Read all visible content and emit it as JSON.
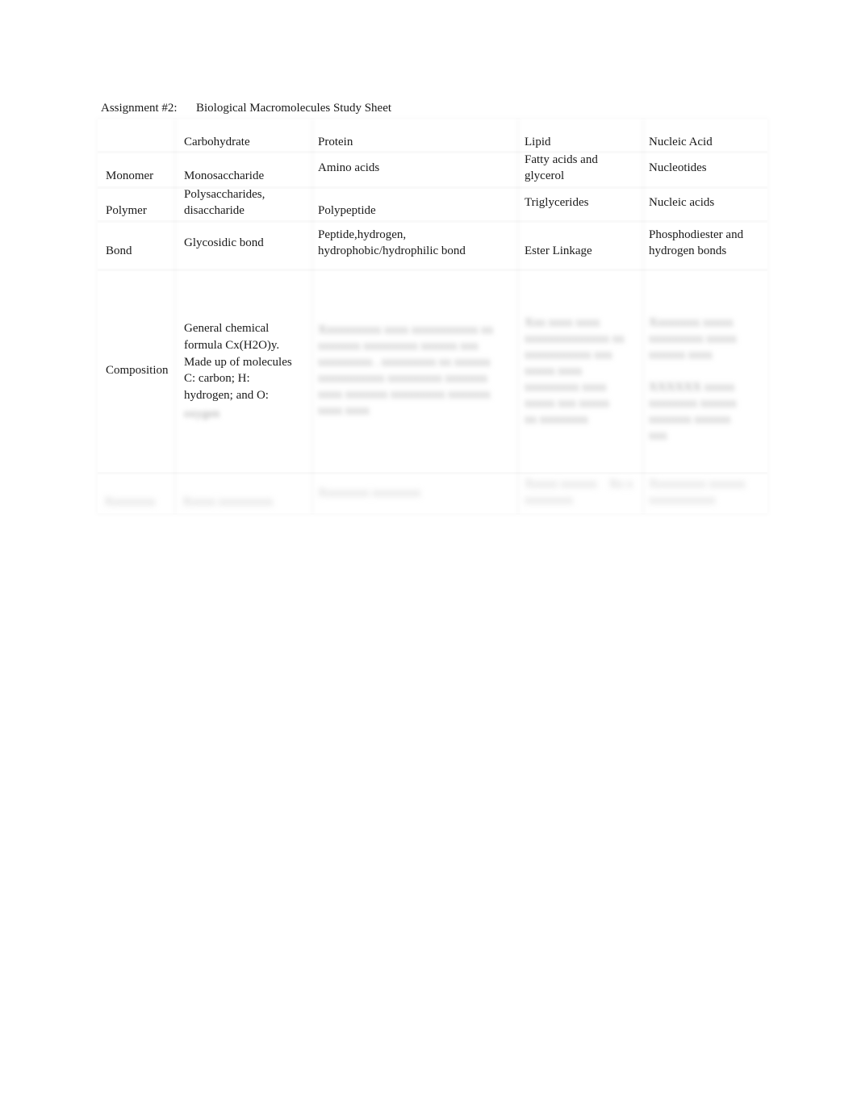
{
  "document": {
    "assignment_label": "Assignment #2:",
    "title": "Biological Macromolecules Study Sheet"
  },
  "table": {
    "columns": [
      "",
      "Carbohydrate",
      "Protein",
      "Lipid",
      "Nucleic Acid"
    ],
    "rows": [
      {
        "label": "Monomer",
        "carbohydrate": "Monosaccharide",
        "protein": "Amino acids",
        "lipid": "Fatty acids and glycerol",
        "nucleic_acid": "Nucleotides"
      },
      {
        "label": "Polymer",
        "carbohydrate": "Polysaccharides, disaccharide",
        "protein": "Polypeptide",
        "lipid": "Triglycerides",
        "nucleic_acid": "Nucleic acids"
      },
      {
        "label": "Bond",
        "carbohydrate": "Glycosidic bond",
        "protein": "Peptide,hydrogen, hydrophobic/hydrophilic bond",
        "lipid": "Ester Linkage",
        "nucleic_acid": "Phosphodiester and hydrogen bonds"
      },
      {
        "label": "Composition",
        "carbohydrate": "General chemical formula Cx(H2O)y. Made up of molecules C: carbon; H: hydrogen; and O:",
        "carbohydrate_hidden": "oxygen",
        "protein": "Blurred content not legible",
        "lipid": "Blurred content not legible",
        "nucleic_acid": "Blurred content not legible"
      },
      {
        "label": "Function",
        "carbohydrate": "Blurred content",
        "protein": "Blurred content",
        "lipid": "Blurred content",
        "nucleic_acid": "Blurred content"
      }
    ],
    "blur_placeholders": {
      "protein_comp_lines": [
        "Xxxxxxxxxx xxxx xxxxxxxxxxx xx",
        "xxxxxxx xxxxxxxxx xxxxxx xxx",
        "xxxxxxxxx  .  xxxxxxxxx xx xxxxxx",
        "xxxxxxxxxxx xxxxxxxxx xxxxxxx",
        "xxxx xxxxxxx xxxxxxxxx xxxxxxx",
        "xxxx xxxx"
      ],
      "lipid_comp_lines": [
        "Xxx xxxx xxxx",
        "xxxxxxxxxxxxxx xx",
        "xxxxxxxxxxx xxx",
        "xxxxx xxxx",
        "xxxxxxxxx xxxx",
        "xxxxx xxx xxxxx",
        "xx xxxxxxxx"
      ],
      "nucleic_comp_lines": [
        "Xxxxxxxx xxxxx",
        "xxxxxxxxx xxxxx",
        "xxxxxx xxxx",
        "",
        "XXXXXX xxxxx",
        "xxxxxxxx xxxxxx",
        "xxxxxxx xxxxxx",
        "xxx"
      ],
      "function_label": "Xxxxxxxx",
      "function_carb": "Xxxxx xxxxxxxxx",
      "function_protein": "Xxxxxxxx xxxxxxxx",
      "function_lipid": [
        "Xxxxx xxxxxx    Xx x",
        "xxxxxxxx"
      ],
      "function_nucleic": [
        "Xxxxxxxxx xxxxxx",
        "xxxxxxxxxxx"
      ]
    }
  }
}
